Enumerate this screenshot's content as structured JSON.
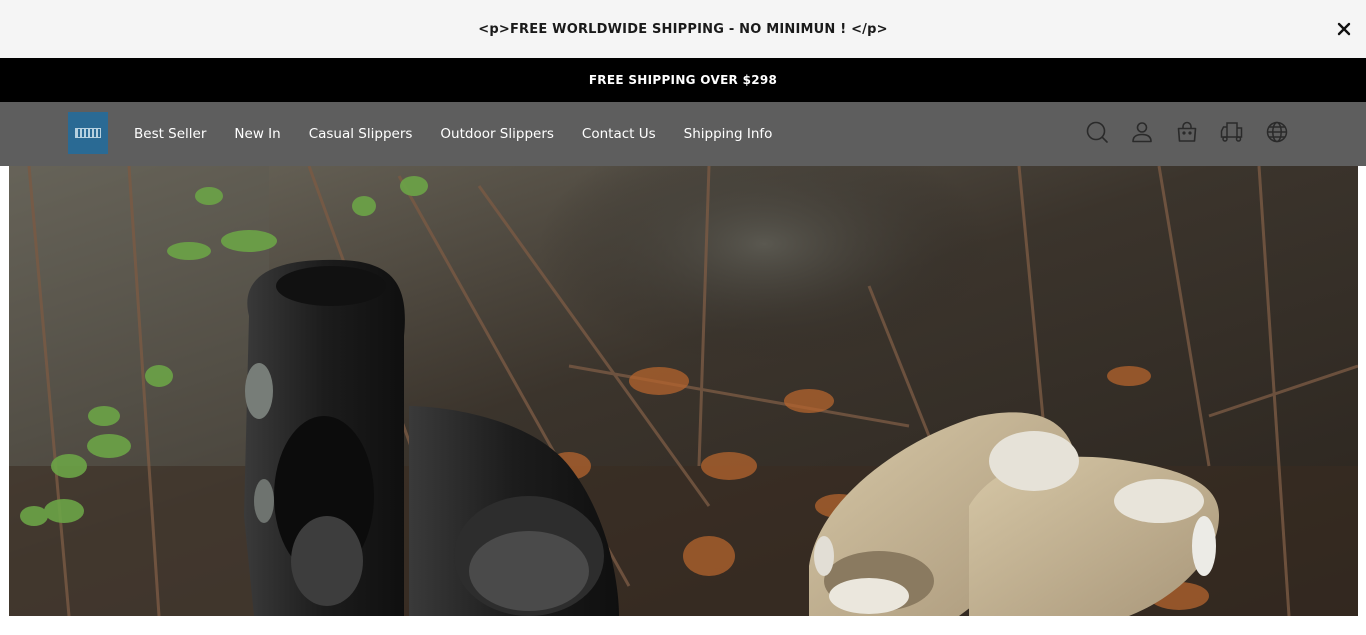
{
  "announcement": {
    "text": "<p>FREE WORLDWIDE SHIPPING - NO MINIMUN ! </p>",
    "close_icon": "close-icon"
  },
  "shipping_bar": {
    "text": "FREE SHIPPING OVER $298"
  },
  "header": {
    "logo_icon": "brand-logo",
    "nav": [
      {
        "label": "Best Seller"
      },
      {
        "label": "New In"
      },
      {
        "label": "Casual Slippers"
      },
      {
        "label": "Outdoor Slippers"
      },
      {
        "label": "Contact Us"
      },
      {
        "label": "Shipping Info"
      }
    ],
    "icons": [
      "search-icon",
      "account-icon",
      "cart-icon",
      "shipping-truck-icon",
      "globe-icon"
    ]
  },
  "hero": {
    "image": "hero-image-slippers-in-forest"
  },
  "colors": {
    "announcement_bg": "#f5f5f5",
    "shipping_bar_bg": "#000000",
    "navbar_bg": "#5e5e5e",
    "logo_bg": "#2a6a94"
  }
}
